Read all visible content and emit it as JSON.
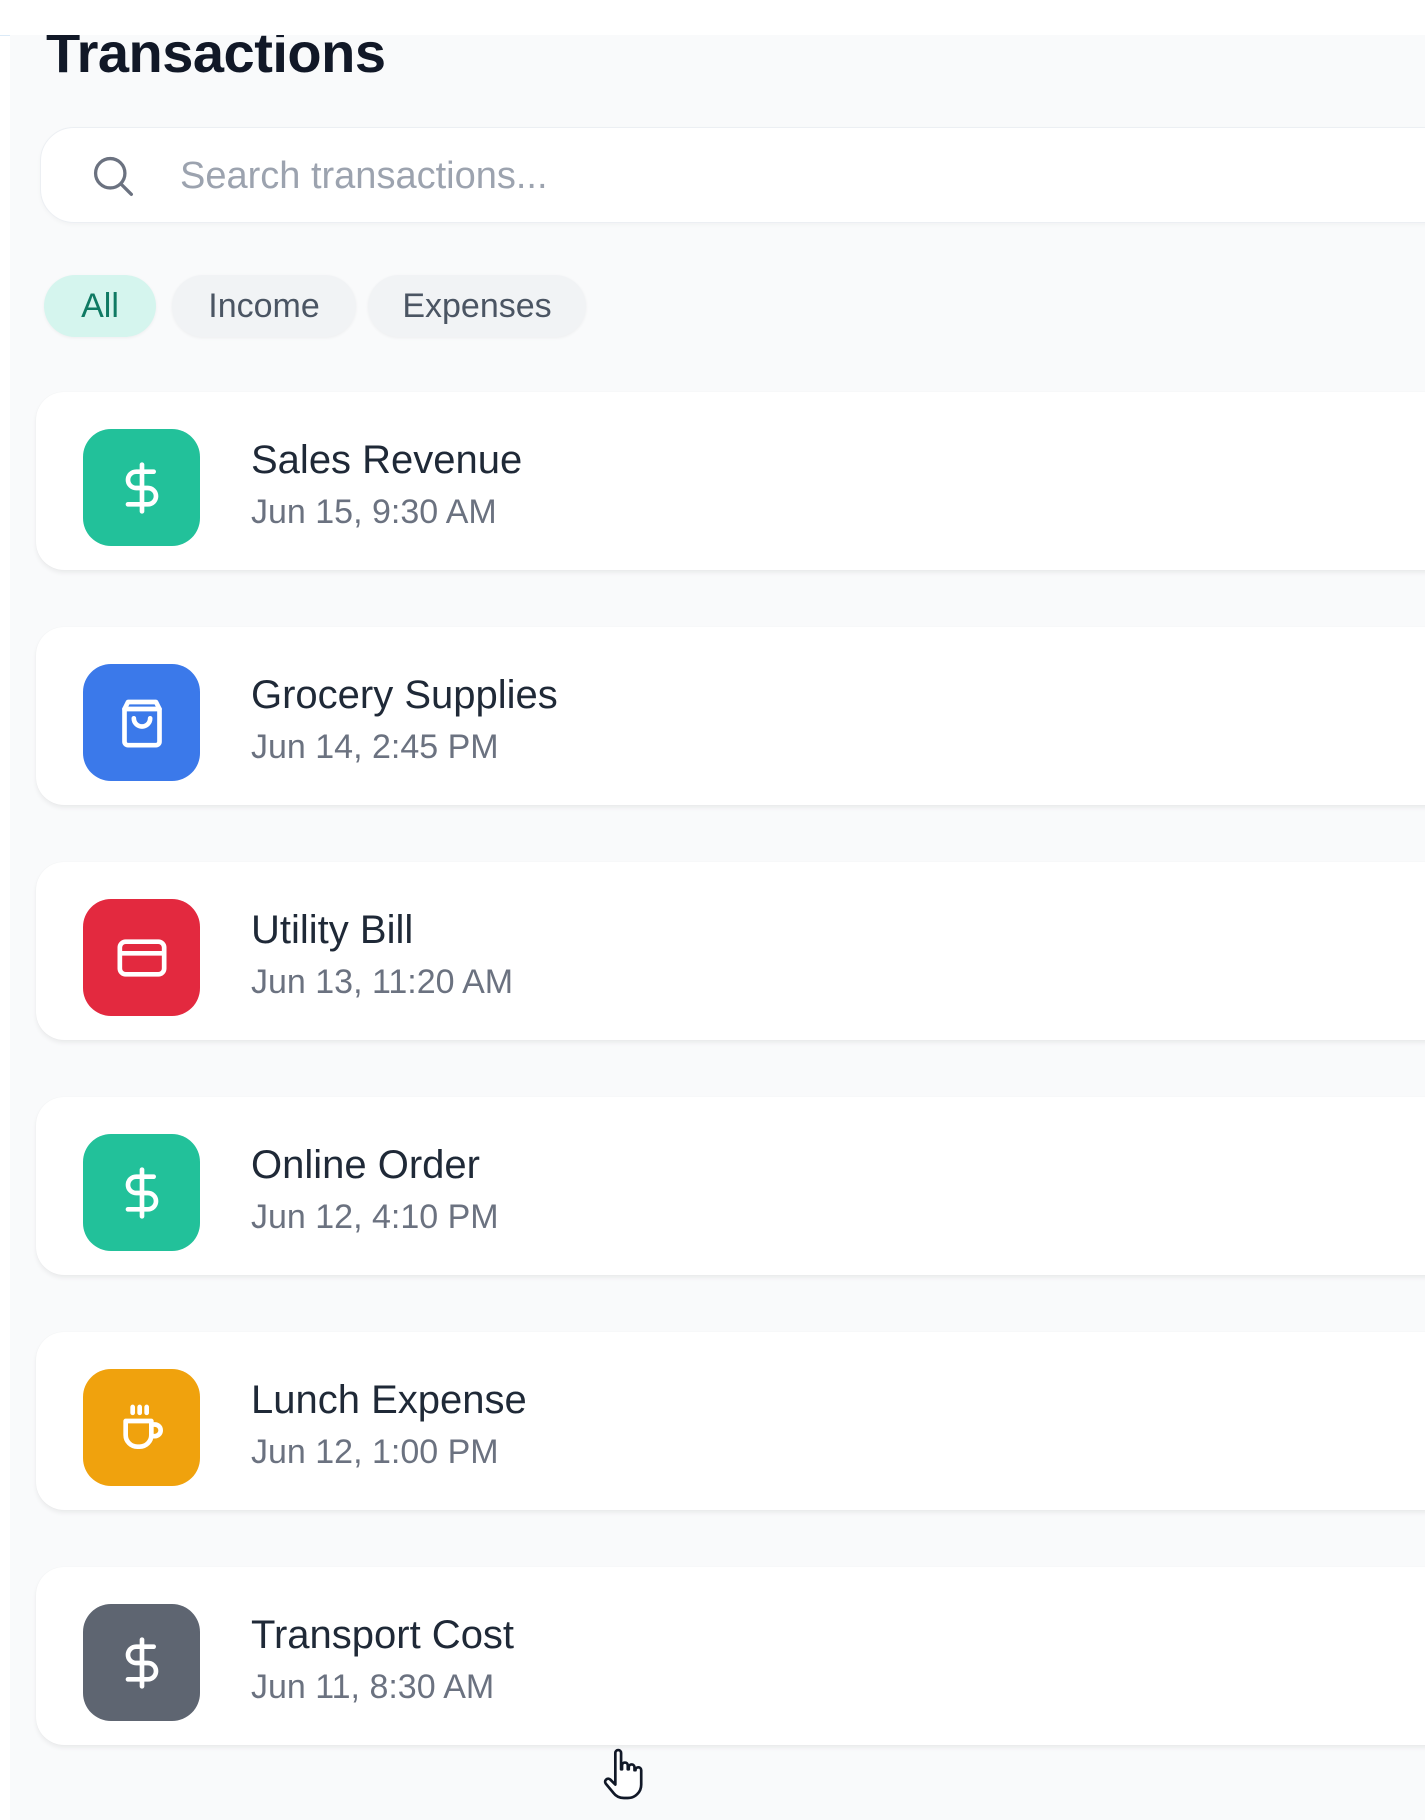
{
  "header": {
    "title": "Transactions"
  },
  "search": {
    "placeholder": "Search transactions..."
  },
  "filters": [
    {
      "label": "All",
      "active": true
    },
    {
      "label": "Income",
      "active": false
    },
    {
      "label": "Expenses",
      "active": false
    }
  ],
  "transactions": [
    {
      "name": "Sales Revenue",
      "time": "Jun 15, 9:30 AM",
      "icon": "dollar-icon",
      "color": "#22c19a"
    },
    {
      "name": "Grocery Supplies",
      "time": "Jun 14, 2:45 PM",
      "icon": "shopping-bag-icon",
      "color": "#3b79ea"
    },
    {
      "name": "Utility Bill",
      "time": "Jun 13, 11:20 AM",
      "icon": "credit-card-icon",
      "color": "#e3293f"
    },
    {
      "name": "Online Order",
      "time": "Jun 12, 4:10 PM",
      "icon": "dollar-icon",
      "color": "#22c19a"
    },
    {
      "name": "Lunch Expense",
      "time": "Jun 12, 1:00 PM",
      "icon": "coffee-cup-icon",
      "color": "#f0a20d"
    },
    {
      "name": "Transport Cost",
      "time": "Jun 11, 8:30 AM",
      "icon": "dollar-icon",
      "color": "#5e6571"
    }
  ]
}
